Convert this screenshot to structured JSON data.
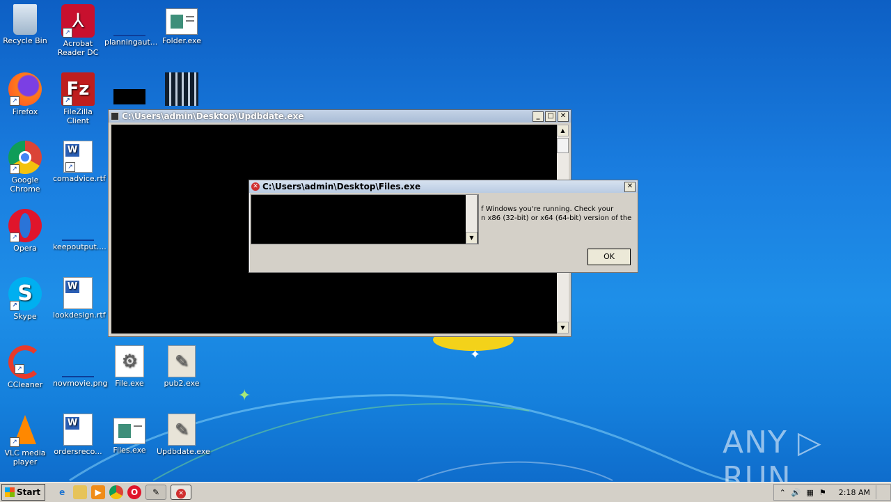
{
  "desktop": {
    "icons": [
      {
        "label": "Recycle Bin"
      },
      {
        "label": "Acrobat Reader DC"
      },
      {
        "label": "planningaut..."
      },
      {
        "label": "Folder.exe"
      },
      {
        "label": "Firefox"
      },
      {
        "label": "FileZilla Client"
      },
      {
        "label": "Google Chrome"
      },
      {
        "label": "comadvice.rtf"
      },
      {
        "label": "Opera"
      },
      {
        "label": "keepoutput...."
      },
      {
        "label": "Skype"
      },
      {
        "label": "lookdesign.rtf"
      },
      {
        "label": "CCleaner"
      },
      {
        "label": "novmovie.png"
      },
      {
        "label": "File.exe"
      },
      {
        "label": "pub2.exe"
      },
      {
        "label": "VLC media player"
      },
      {
        "label": "ordersreco..."
      },
      {
        "label": "Files.exe"
      },
      {
        "label": "Updbdate.exe"
      }
    ]
  },
  "console_window": {
    "title": "C:\\Users\\admin\\Desktop\\Updbdate.exe",
    "min": "_",
    "max": "□",
    "close": "✕"
  },
  "error_dialog": {
    "title": "C:\\Users\\admin\\Desktop\\Files.exe",
    "close": "✕",
    "message_line1": "f Windows you're running. Check your",
    "message_line2": "n x86 (32-bit) or x64 (64-bit) version of the",
    "ok": "OK"
  },
  "taskbar": {
    "start": "Start",
    "clock": "2:18 AM"
  },
  "watermark": "ANY ▷ RUN",
  "colors": {
    "desktop": "#1a7ee0",
    "console": "#000000",
    "chrome": "#d4d0c8",
    "error_red": "#d03030"
  }
}
